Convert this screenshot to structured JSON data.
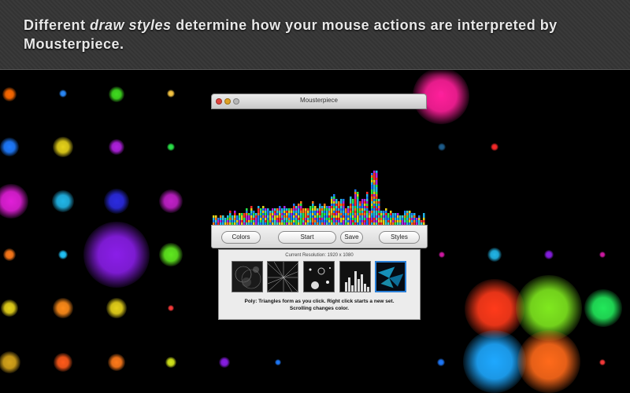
{
  "banner": {
    "prefix": "Different ",
    "emphasis": "draw styles",
    "suffix": " determine how your mouse actions are interpreted by Mousterpiece."
  },
  "window": {
    "title": "Mousterpiece"
  },
  "toolbar": {
    "colors_label": "Colors",
    "start_label": "Start",
    "save_label": "Save",
    "styles_label": "Styles"
  },
  "styles_panel": {
    "resolution_text": "Current Resolution: 1920 x 1080",
    "thumbnails": [
      "nebula-style-thumbnail",
      "starburst-style-thumbnail",
      "circles-style-thumbnail",
      "bars-style-thumbnail",
      "poly-style-thumbnail"
    ],
    "selected_index": 4,
    "description_line1": "Poly: Triangles form as you click.  Right click starts a new set.",
    "description_line2": "Scrolling changes color."
  },
  "colors": {
    "accent_blue": "#2a7fd6",
    "background": "#000000",
    "banner": "#363636"
  }
}
